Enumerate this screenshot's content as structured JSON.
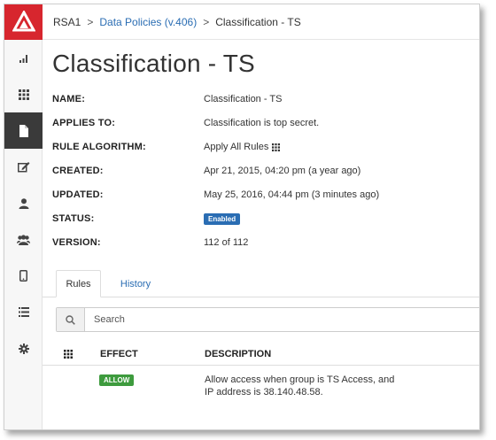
{
  "breadcrumb": {
    "root": "RSA1",
    "separator": ">",
    "link": "Data Policies (v.406)",
    "current": "Classification - TS"
  },
  "page": {
    "title": "Classification - TS"
  },
  "properties": [
    {
      "key": "NAME:",
      "value": "Classification - TS"
    },
    {
      "key": "APPLIES TO:",
      "value": "Classification is top secret."
    },
    {
      "key": "RULE ALGORITHM:",
      "value": "Apply All Rules"
    },
    {
      "key": "CREATED:",
      "value": "Apr 21, 2015, 04:20 pm (a year ago)"
    },
    {
      "key": "UPDATED:",
      "value": "May 25, 2016, 04:44 pm (3 minutes ago)"
    },
    {
      "key": "STATUS:",
      "value": "Enabled"
    },
    {
      "key": "VERSION:",
      "value": "112 of 112"
    }
  ],
  "tabs": [
    {
      "label": "Rules",
      "active": true
    },
    {
      "label": "History",
      "active": false
    }
  ],
  "search": {
    "placeholder": "Search",
    "value": ""
  },
  "table": {
    "columns": [
      "EFFECT",
      "DESCRIPTION"
    ],
    "rows": [
      {
        "effect": "ALLOW",
        "description_line1": "Allow access when group is TS Access, and",
        "description_line2": "IP address is 38.140.48.58."
      }
    ]
  },
  "sidebar": {
    "icons": [
      "bar-chart-icon",
      "grid-icon",
      "document-icon",
      "edit-icon",
      "user-icon",
      "users-icon",
      "mobile-icon",
      "list-icon",
      "gear-icon"
    ],
    "active_index": 2
  },
  "colors": {
    "brand": "#d7262e",
    "link": "#2a6db3",
    "enabled_badge": "#2a6db3",
    "allow_badge": "#3e9b3e",
    "sidebar_active": "#3a3a3a"
  }
}
